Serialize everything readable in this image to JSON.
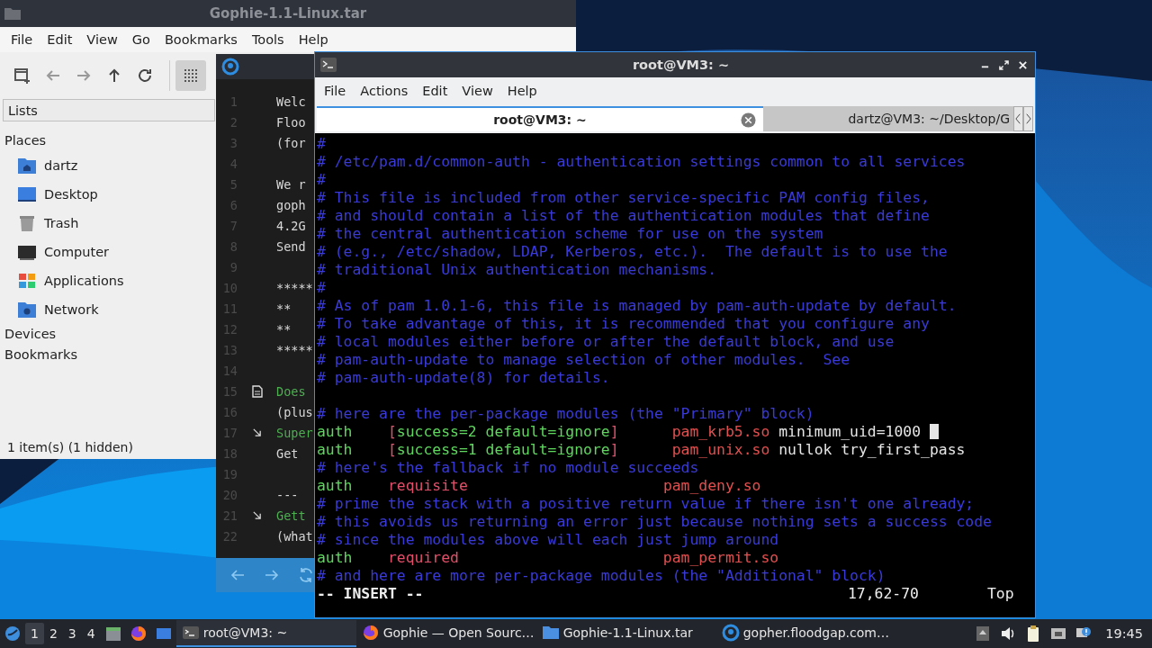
{
  "file_manager": {
    "title": "Gophie-1.1-Linux.tar",
    "menu": [
      "File",
      "Edit",
      "View",
      "Go",
      "Bookmarks",
      "Tools",
      "Help"
    ],
    "toolbar": [
      {
        "kind": "new-tab",
        "selected": false
      },
      {
        "kind": "back",
        "selected": false
      },
      {
        "kind": "forward",
        "selected": false
      },
      {
        "kind": "up",
        "selected": false
      },
      {
        "kind": "reload",
        "selected": false
      },
      {
        "kind": "icon-view",
        "selected": true
      }
    ],
    "panel_mode": "Lists",
    "sections": [
      {
        "label": "Places",
        "items": [
          {
            "label": "dartz",
            "kind": "home"
          },
          {
            "label": "Desktop",
            "kind": "desktop"
          },
          {
            "label": "Trash",
            "kind": "trash"
          },
          {
            "label": "Computer",
            "kind": "computer"
          },
          {
            "label": "Applications",
            "kind": "applications"
          },
          {
            "label": "Network",
            "kind": "network"
          }
        ]
      },
      {
        "label": "Devices"
      },
      {
        "label": "Bookmarks"
      }
    ],
    "status": "1 item(s) (1 hidden)"
  },
  "gophie": {
    "lines": [
      {
        "number": "1",
        "text": "Welc",
        "kind": "text"
      },
      {
        "number": "2",
        "text": "Floo",
        "kind": "text"
      },
      {
        "number": "3",
        "text": "(for",
        "kind": "text"
      },
      {
        "number": "4",
        "kind": "text"
      },
      {
        "number": "5",
        "text": "We r",
        "kind": "text"
      },
      {
        "number": "6",
        "text": "goph",
        "kind": "text"
      },
      {
        "number": "7",
        "text": "4.2G",
        "kind": "text"
      },
      {
        "number": "8",
        "text": "Send",
        "kind": "text"
      },
      {
        "number": "9",
        "kind": "text"
      },
      {
        "number": "10",
        "text": "*****",
        "kind": "text"
      },
      {
        "number": "11",
        "text": "**",
        "kind": "text"
      },
      {
        "number": "12",
        "text": "**",
        "kind": "text"
      },
      {
        "number": "13",
        "text": "*****",
        "kind": "text"
      },
      {
        "number": "14",
        "kind": "text"
      },
      {
        "number": "15",
        "text": "Does",
        "kind": "document"
      },
      {
        "number": "16",
        "text": "(plus",
        "kind": "text"
      },
      {
        "number": "17",
        "text": "Super",
        "kind": "link"
      },
      {
        "number": "18",
        "text": "Get",
        "kind": "text"
      },
      {
        "number": "19",
        "kind": "text"
      },
      {
        "number": "20",
        "text": "---",
        "kind": "text"
      },
      {
        "number": "21",
        "text": "Gett",
        "kind": "link"
      },
      {
        "number": "22",
        "text": "(what",
        "kind": "text"
      }
    ]
  },
  "terminal": {
    "title": "root@VM3: ~",
    "menu": [
      "File",
      "Actions",
      "Edit",
      "View",
      "Help"
    ],
    "tabs": [
      {
        "label": "root@VM3: ~",
        "selected": true
      },
      {
        "label": "dartz@VM3: ~/Desktop/G",
        "selected": false
      }
    ],
    "lines": [
      {
        "cursor": false,
        "segments": [
          {
            "text": "#",
            "kind": "comment"
          }
        ]
      },
      {
        "cursor": false,
        "segments": [
          {
            "text": "# /etc/pam.d/common-auth - authentication settings common to all services",
            "kind": "comment"
          }
        ]
      },
      {
        "cursor": false,
        "segments": [
          {
            "text": "#",
            "kind": "comment"
          }
        ]
      },
      {
        "cursor": false,
        "segments": [
          {
            "text": "# This file is included from other service-specific PAM config files,",
            "kind": "comment"
          }
        ]
      },
      {
        "cursor": false,
        "segments": [
          {
            "text": "# and should contain a list of the authentication modules that define",
            "kind": "comment"
          }
        ]
      },
      {
        "cursor": false,
        "segments": [
          {
            "text": "# the central authentication scheme for use on the system",
            "kind": "comment"
          }
        ]
      },
      {
        "cursor": false,
        "segments": [
          {
            "text": "# (e.g., /etc/shadow, LDAP, Kerberos, etc.).  The default is to use the",
            "kind": "comment"
          }
        ]
      },
      {
        "cursor": false,
        "segments": [
          {
            "text": "# traditional Unix authentication mechanisms.",
            "kind": "comment"
          }
        ]
      },
      {
        "cursor": false,
        "segments": [
          {
            "text": "#",
            "kind": "comment"
          }
        ]
      },
      {
        "cursor": false,
        "segments": [
          {
            "text": "# As of pam 1.0.1-6, this file is managed by pam-auth-update by default.",
            "kind": "comment"
          }
        ]
      },
      {
        "cursor": false,
        "segments": [
          {
            "text": "# To take advantage of this, it is recommended that you configure any",
            "kind": "comment"
          }
        ]
      },
      {
        "cursor": false,
        "segments": [
          {
            "text": "# local modules either before or after the default block, and use",
            "kind": "comment"
          }
        ]
      },
      {
        "cursor": false,
        "segments": [
          {
            "text": "# pam-auth-update to manage selection of other modules.  See",
            "kind": "comment"
          }
        ]
      },
      {
        "cursor": false,
        "segments": [
          {
            "text": "# pam-auth-update(8) for details.",
            "kind": "comment"
          }
        ]
      },
      {
        "cursor": false
      },
      {
        "cursor": false,
        "segments": [
          {
            "text": "# here are the per-package modules (the \"Primary\" block)",
            "kind": "comment"
          }
        ]
      },
      {
        "cursor": true,
        "segments": [
          {
            "text": "auth",
            "kind": "keyword"
          },
          {
            "text": "    [",
            "kind": "bracket"
          },
          {
            "text": "success=2 default=ignore",
            "kind": "control"
          },
          {
            "text": "]",
            "kind": "bracket"
          },
          {
            "text": "      pam_krb5.so",
            "kind": "module"
          },
          {
            "text": " minimum_uid=1000",
            "kind": "plain"
          }
        ]
      },
      {
        "cursor": false,
        "segments": [
          {
            "text": "auth",
            "kind": "keyword"
          },
          {
            "text": "    [",
            "kind": "bracket"
          },
          {
            "text": "success=1 default=ignore",
            "kind": "control"
          },
          {
            "text": "]",
            "kind": "bracket"
          },
          {
            "text": "      pam_unix.so",
            "kind": "module"
          },
          {
            "text": " nullok try_first_pass",
            "kind": "plain"
          }
        ]
      },
      {
        "cursor": false,
        "segments": [
          {
            "text": "# here's the fallback if no module succeeds",
            "kind": "comment"
          }
        ]
      },
      {
        "cursor": false,
        "segments": [
          {
            "text": "auth",
            "kind": "keyword"
          },
          {
            "text": "    requisite",
            "kind": "bracket"
          },
          {
            "text": "                      pam_deny.so",
            "kind": "module"
          }
        ]
      },
      {
        "cursor": false,
        "segments": [
          {
            "text": "# prime the stack with a positive return value if there isn't one already;",
            "kind": "comment"
          }
        ]
      },
      {
        "cursor": false,
        "segments": [
          {
            "text": "# this avoids us returning an error just because nothing sets a success code",
            "kind": "comment"
          }
        ]
      },
      {
        "cursor": false,
        "segments": [
          {
            "text": "# since the modules above will each just jump around",
            "kind": "comment"
          }
        ]
      },
      {
        "cursor": false,
        "segments": [
          {
            "text": "auth",
            "kind": "keyword"
          },
          {
            "text": "    required",
            "kind": "bracket"
          },
          {
            "text": "                       pam_permit.so",
            "kind": "module"
          }
        ]
      },
      {
        "cursor": false,
        "segments": [
          {
            "text": "# and here are more per-package modules (the \"Additional\" block)",
            "kind": "comment"
          }
        ]
      }
    ],
    "status": {
      "mode": "-- INSERT --",
      "position": "17,62-70",
      "scroll": "Top"
    }
  },
  "taskbar": {
    "workspaces": [
      {
        "label": "1",
        "selected": true
      },
      {
        "label": "2",
        "selected": false
      },
      {
        "label": "3",
        "selected": false
      },
      {
        "label": "4",
        "selected": false
      }
    ],
    "launchers": [
      {
        "kind": "files"
      },
      {
        "kind": "browser"
      },
      {
        "kind": "desktop"
      }
    ],
    "tasks": [
      {
        "label": "root@VM3: ~",
        "kind": "terminal",
        "selected": true
      },
      {
        "label": "Gophie — Open Sourc…",
        "kind": "browser",
        "selected": false
      },
      {
        "label": "Gophie-1.1-Linux.tar",
        "kind": "folder",
        "selected": false
      },
      {
        "label": "gopher.floodgap.com…",
        "kind": "gopher",
        "selected": false
      }
    ],
    "clock": "19:45"
  }
}
